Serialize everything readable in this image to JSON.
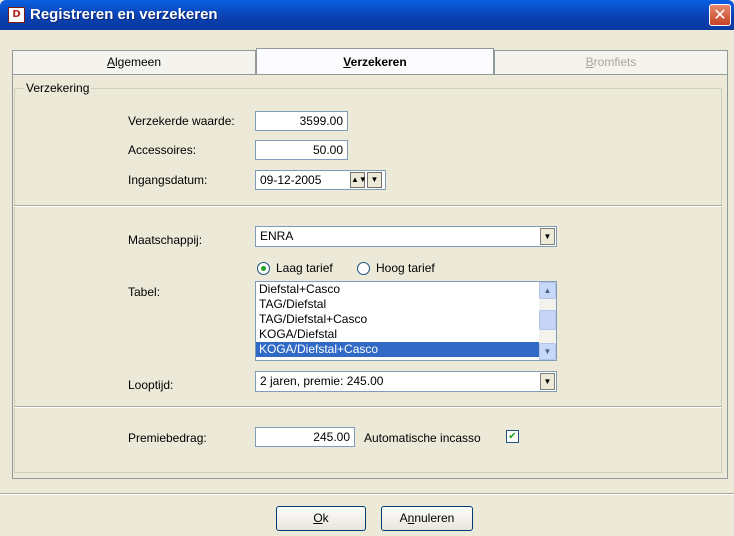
{
  "window": {
    "title": "Registreren en verzekeren",
    "icon_text": "D",
    "icon": "app-icon",
    "close_icon": "close-icon"
  },
  "tabs": [
    {
      "label_accel": "A",
      "label_rest": "lgemeen",
      "state": "normal"
    },
    {
      "label_accel": "V",
      "label_rest": "erzekeren",
      "state": "selected"
    },
    {
      "label_accel": "B",
      "label_rest": "romfiets",
      "state": "disabled"
    }
  ],
  "group": {
    "label": "Verzekering"
  },
  "fields": {
    "verzekerde_waarde": {
      "label": "Verzekerde waarde:",
      "value": "3599.00"
    },
    "accessoires": {
      "label": "Accessoires:",
      "value": "50.00"
    },
    "ingangsdatum": {
      "label": "Ingangsdatum:",
      "value": "09-12-2005"
    },
    "maatschappij": {
      "label": "Maatschappij:",
      "value": "ENRA"
    },
    "tarief": {
      "laag": "Laag tarief",
      "hoog": "Hoog tarief",
      "selected": "laag"
    },
    "tabel": {
      "label": "Tabel:",
      "items": [
        "Diefstal+Casco",
        "TAG/Diefstal",
        "TAG/Diefstal+Casco",
        "KOGA/Diefstal",
        "KOGA/Diefstal+Casco"
      ],
      "selected_index": 4
    },
    "looptijd": {
      "label": "Looptijd:",
      "value": "2 jaren, premie: 245.00"
    },
    "premiebedrag": {
      "label": "Premiebedrag:",
      "value": "245.00"
    },
    "incasso": {
      "label": "Automatische incasso",
      "checked": true
    }
  },
  "buttons": {
    "ok": {
      "accel": "O",
      "rest": "k"
    },
    "annuleren": {
      "pre": "A",
      "accel": "n",
      "rest": "nuleren"
    }
  },
  "colors": {
    "titlebar": "#0a3fb0",
    "selection": "#316ac5",
    "dialog_bg": "#ece9d8"
  }
}
